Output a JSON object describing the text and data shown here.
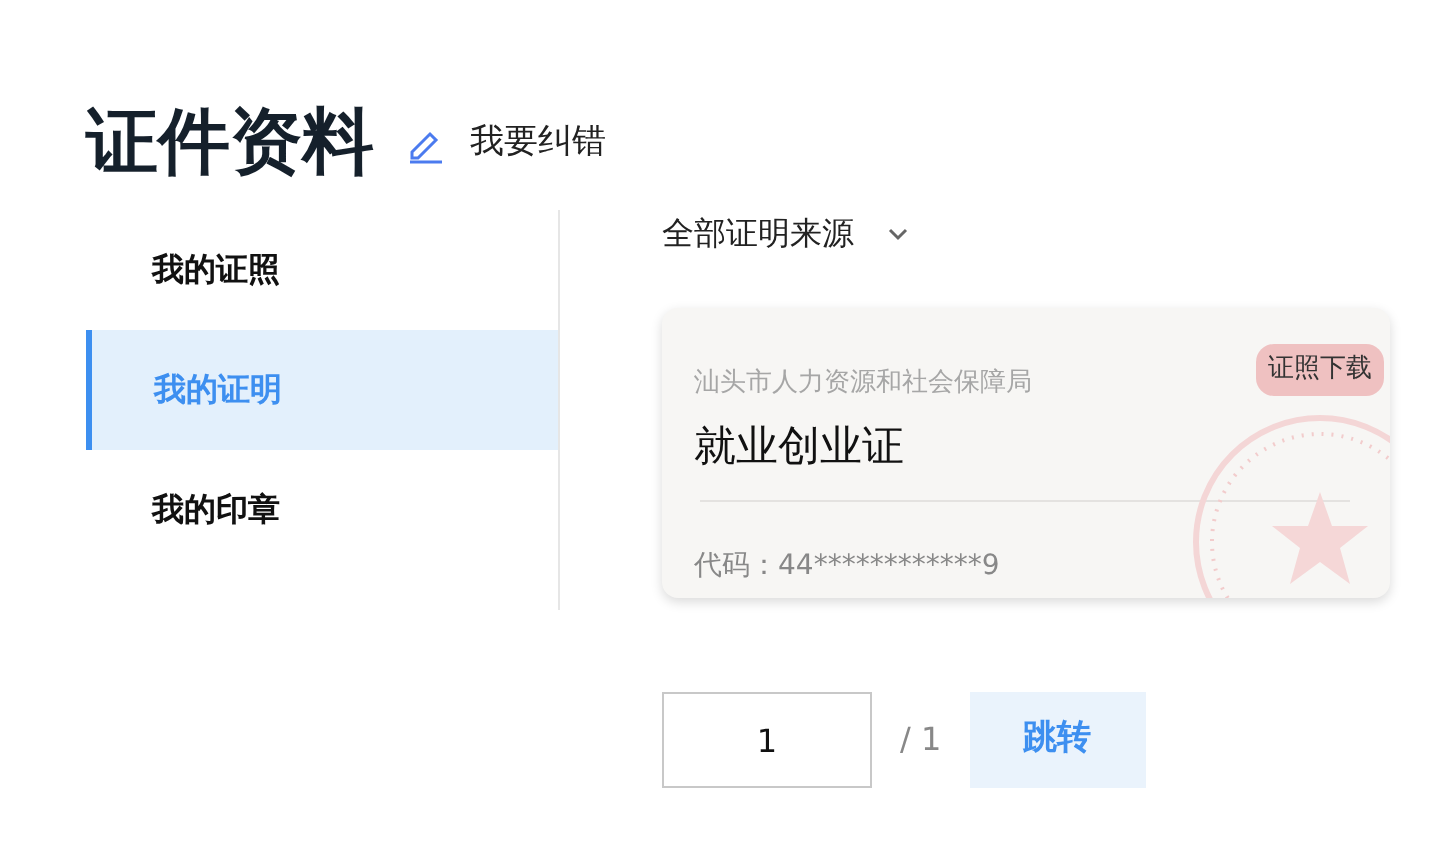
{
  "header": {
    "title": "证件资料",
    "correction_link": "我要纠错"
  },
  "sidebar": {
    "items": [
      {
        "label": "我的证照",
        "selected": false
      },
      {
        "label": "我的证明",
        "selected": true
      },
      {
        "label": "我的印章",
        "selected": false
      }
    ]
  },
  "filter": {
    "label": "全部证明来源"
  },
  "cards": [
    {
      "issuer": "汕头市人力资源和社会保障局",
      "name": "就业创业证",
      "download": "证照下载",
      "code": "代码：44************9"
    }
  ],
  "pagination": {
    "page": "1",
    "total": "/ 1",
    "jump": "跳转"
  }
}
